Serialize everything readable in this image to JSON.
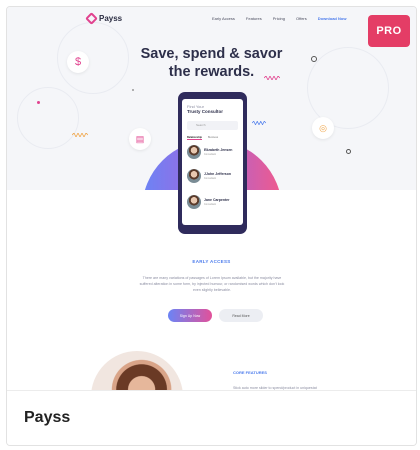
{
  "card": {
    "title": "Payss",
    "badge": "PRO"
  },
  "preview": {
    "nav": {
      "logo": "Payss",
      "links": [
        "Early Access",
        "Features",
        "Pricing",
        "Offers"
      ],
      "cta": "Download Now"
    },
    "hero": {
      "headline_line1": "Save, spend & savor",
      "headline_line2": "the rewards."
    },
    "phone": {
      "find": "Find Your",
      "title": "Trusty Consultor",
      "search_placeholder": "Search",
      "tabs": [
        "Relationship",
        "Business"
      ],
      "consultants": [
        {
          "name": "Elizabeth Jensen",
          "role": "Consultant"
        },
        {
          "name": "JJohn Jefferson",
          "role": "Consultant"
        },
        {
          "name": "Jane Carpenter",
          "role": "Consultant"
        }
      ]
    },
    "early_access": {
      "label": "EARLY ACCESS",
      "text": "There are many variations of passages of Lorem Ipsum available, but the majority have suffered alteration in some form, by injected humour, or randomised words which don't look even slightly believable.",
      "primary_button": "Sign Up Now",
      "secondary_button": "Read More"
    },
    "core_features": {
      "label": "CORE FEATURES",
      "text": "Stick auto more slider to spend/product in uniquestat"
    }
  },
  "colors": {
    "accent_pink": "#e43d66",
    "accent_blue": "#4b7bec",
    "heading": "#2d2f4a"
  }
}
